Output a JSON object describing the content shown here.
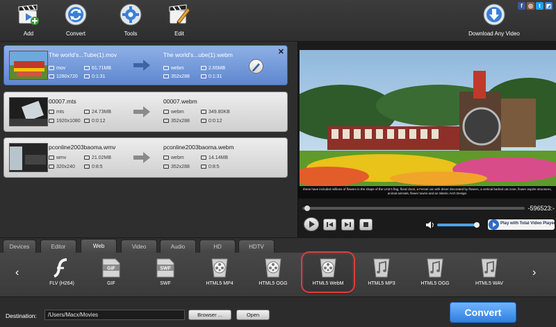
{
  "toolbar": {
    "add_label": "Add",
    "convert_label": "Convert",
    "tools_label": "Tools",
    "edit_label": "Edit",
    "download_label": "Download Any Video"
  },
  "social": {
    "facebook": "f",
    "instagram": "◎",
    "twitter": "t",
    "share": "◩"
  },
  "files": [
    {
      "source_name": "The world's...Tube(1).mov",
      "source_format": "mov",
      "source_size": "61.71MB",
      "source_resolution": "1280x720",
      "source_duration": "0:1:31",
      "target_name": "The world's...ube(1).webm",
      "target_format": "webm",
      "target_size": "2.65MB",
      "target_resolution": "352x288",
      "target_duration": "0:1:31",
      "selected": true
    },
    {
      "source_name": "00007.mts",
      "source_format": "mts",
      "source_size": "24.73MB",
      "source_resolution": "1920x1080",
      "source_duration": "0:0:12",
      "target_name": "00007.webm",
      "target_format": "webm",
      "target_size": "349.80KB",
      "target_resolution": "352x288",
      "target_duration": "0:0:12",
      "selected": false
    },
    {
      "source_name": "pconline2003baoma.wmv",
      "source_format": "wmv",
      "source_size": "21.02MB",
      "source_resolution": "320x240",
      "source_duration": "0:8:5",
      "target_name": "pconline2003baoma.webm",
      "target_format": "webm",
      "target_size": "14.14MB",
      "target_resolution": "352x288",
      "target_duration": "0:8:5",
      "selected": false
    }
  ],
  "preview": {
    "caption": "these have included millions of flowers in the shape of the UAE's flag, floral clock, a Ferrari car with driver decorated by flowers, a vertical barbed cat zone, flower aspirie structures, animal animals, flower towns and an Islamic Arch Design.",
    "time": "-596523:-",
    "scrub_progress": 0.01,
    "volume": 0.95,
    "play_total_label": "Play with Total Video Player"
  },
  "tabs": [
    "Devices",
    "Editor",
    "Web",
    "Video",
    "Audio",
    "HD",
    "HDTV"
  ],
  "active_tab": "Web",
  "formats": [
    {
      "label": "FLV (H264)",
      "icon": "flash-icon"
    },
    {
      "label": "GIF",
      "icon": "gif-file-icon"
    },
    {
      "label": "SWF",
      "icon": "swf-file-icon"
    },
    {
      "label": "HTML5 MP4",
      "icon": "film-reel-icon"
    },
    {
      "label": "HTML5 OGG",
      "icon": "film-reel-icon"
    },
    {
      "label": "HTML5 WebM",
      "icon": "film-reel-icon"
    },
    {
      "label": "HTML5 MP3",
      "icon": "music-note-icon"
    },
    {
      "label": "HTML5 OGG",
      "icon": "music-note-icon"
    },
    {
      "label": "HTML5 WAV",
      "icon": "music-note-icon"
    }
  ],
  "selected_format": "HTML5 WebM",
  "bottom": {
    "destination_label": "Destination:",
    "destination_path": "/Users/Macx/Movies",
    "browse_label": "Browser ...",
    "open_label": "Open",
    "convert_label": "Convert"
  },
  "colors": {
    "accent": "#2f7fe0",
    "selection": "#6e93d8",
    "highlight_ring": "#e23b3b"
  }
}
